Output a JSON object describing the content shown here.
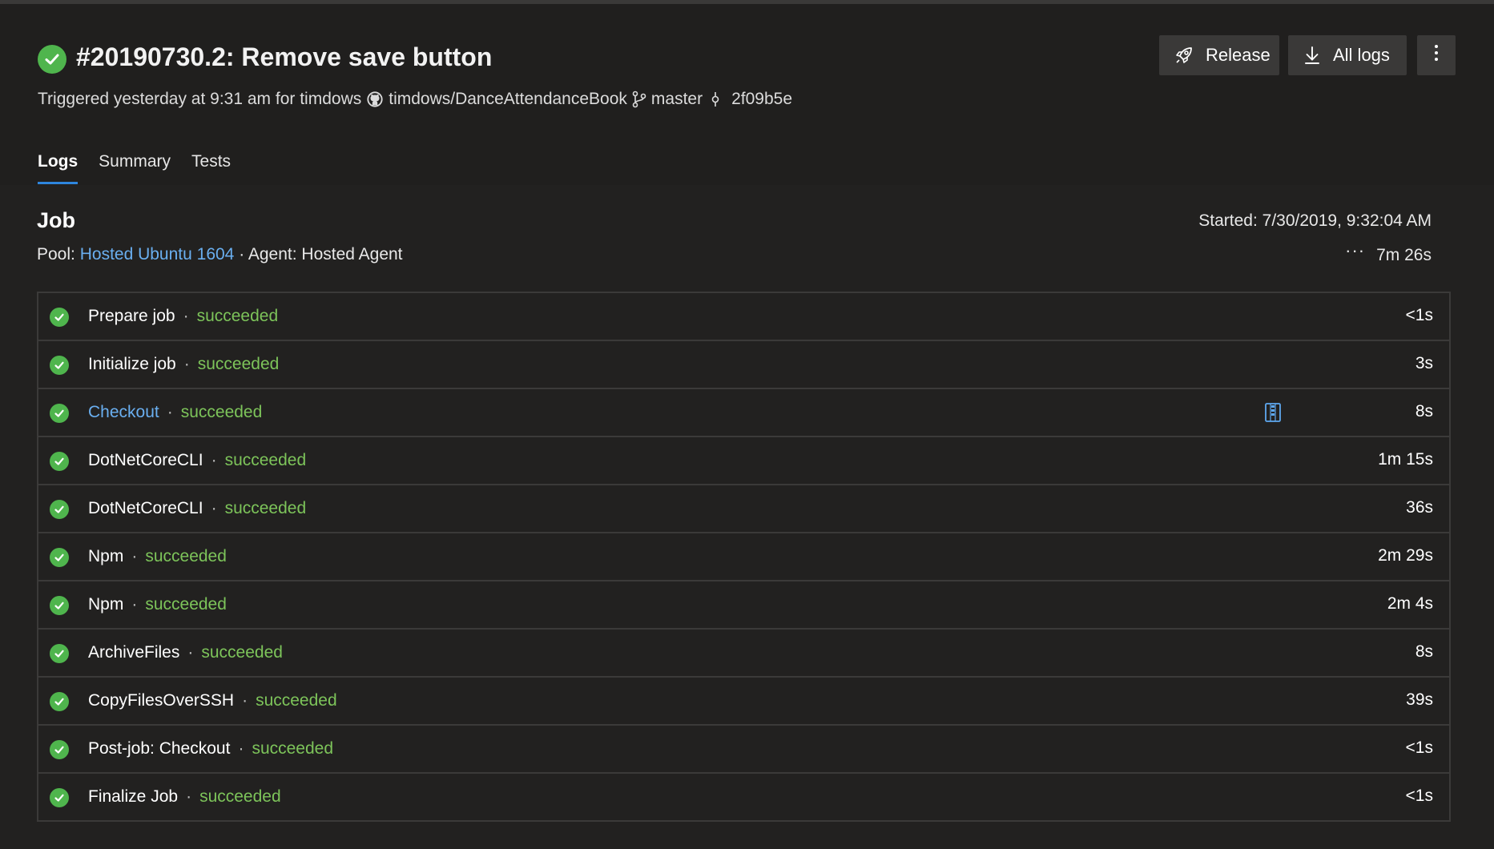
{
  "build": {
    "title": "#20190730.2: Remove save button",
    "trigger_text": "Triggered yesterday at 9:31 am for timdows",
    "repo": "timdows/DanceAttendanceBook",
    "branch": "master",
    "commit": "2f09b5e",
    "status": "succeeded"
  },
  "actions": {
    "release_label": "Release",
    "all_logs_label": "All logs"
  },
  "tabs": [
    {
      "label": "Logs",
      "active": true
    },
    {
      "label": "Summary",
      "active": false
    },
    {
      "label": "Tests",
      "active": false
    }
  ],
  "job": {
    "title": "Job",
    "pool_label": "Pool:",
    "pool_name": "Hosted Ubuntu 1604",
    "agent_text": "· Agent: Hosted Agent",
    "started_text": "Started: 7/30/2019, 9:32:04 AM",
    "duration": "7m 26s"
  },
  "steps": [
    {
      "name": "Prepare job",
      "result": "succeeded",
      "duration": "<1s"
    },
    {
      "name": "Initialize job",
      "result": "succeeded",
      "duration": "3s"
    },
    {
      "name": "Checkout",
      "result": "succeeded",
      "duration": "8s",
      "link": true,
      "artifact_icon": "zip-icon"
    },
    {
      "name": "DotNetCoreCLI",
      "result": "succeeded",
      "duration": "1m 15s"
    },
    {
      "name": "DotNetCoreCLI",
      "result": "succeeded",
      "duration": "36s"
    },
    {
      "name": "Npm",
      "result": "succeeded",
      "duration": "2m 29s"
    },
    {
      "name": "Npm",
      "result": "succeeded",
      "duration": "2m 4s"
    },
    {
      "name": "ArchiveFiles",
      "result": "succeeded",
      "duration": "8s"
    },
    {
      "name": "CopyFilesOverSSH",
      "result": "succeeded",
      "duration": "39s"
    },
    {
      "name": "Post-job: Checkout",
      "result": "succeeded",
      "duration": "<1s"
    },
    {
      "name": "Finalize Job",
      "result": "succeeded",
      "duration": "<1s"
    }
  ],
  "colors": {
    "success": "#4fb54d",
    "success_text": "#7dc45a",
    "link": "#6aaff0",
    "tab_underline": "#2e86de"
  }
}
